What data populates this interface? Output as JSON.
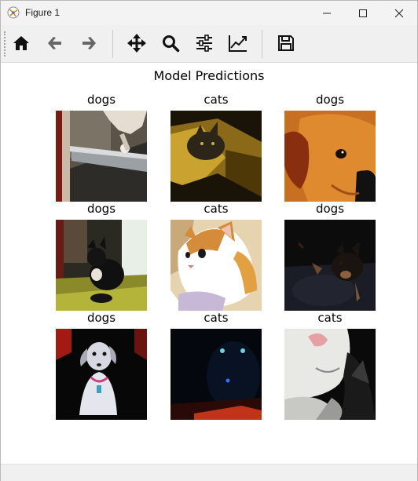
{
  "window": {
    "title": "Figure 1",
    "controls": [
      "minimize",
      "maximize",
      "close"
    ]
  },
  "toolbar": {
    "tools": [
      {
        "name": "home",
        "icon": "home-icon"
      },
      {
        "name": "back",
        "icon": "arrow-left-icon"
      },
      {
        "name": "forward",
        "icon": "arrow-right-icon"
      },
      {
        "name": "pan",
        "icon": "move-icon"
      },
      {
        "name": "zoom",
        "icon": "magnifier-icon"
      },
      {
        "name": "subplots",
        "icon": "sliders-icon"
      },
      {
        "name": "edit-axis",
        "icon": "line-chart-icon"
      },
      {
        "name": "save",
        "icon": "floppy-disk-icon"
      }
    ]
  },
  "figure": {
    "title": "Model Predictions",
    "images": [
      {
        "label": "dogs",
        "subject": "dog"
      },
      {
        "label": "cats",
        "subject": "cat"
      },
      {
        "label": "dogs",
        "subject": "dog"
      },
      {
        "label": "dogs",
        "subject": "dog"
      },
      {
        "label": "cats",
        "subject": "cat"
      },
      {
        "label": "dogs",
        "subject": "dog"
      },
      {
        "label": "dogs",
        "subject": "dog"
      },
      {
        "label": "cats",
        "subject": "cat"
      },
      {
        "label": "cats",
        "subject": "cat"
      }
    ]
  }
}
